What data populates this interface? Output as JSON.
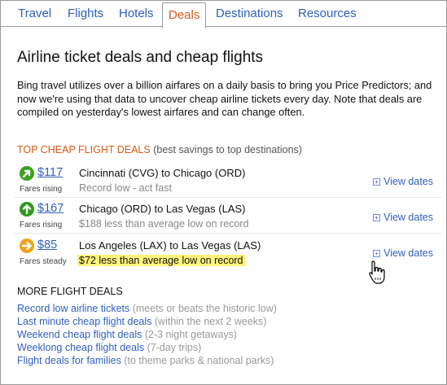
{
  "tabs": [
    {
      "label": "Travel",
      "active": false
    },
    {
      "label": "Flights",
      "active": false
    },
    {
      "label": "Hotels",
      "active": false
    },
    {
      "label": "Deals",
      "active": true
    },
    {
      "label": "Destinations",
      "active": false
    },
    {
      "label": "Resources",
      "active": false
    }
  ],
  "page_title": "Airline ticket deals and cheap flights",
  "intro": "Bing travel utilizes over a billion airfares on a daily basis to bring you Price Predictors; and now we're using that data to uncover cheap airline tickets every day. Note that deals are compiled on yesterday's lowest airfares and can change often.",
  "top_deals": {
    "title": "TOP CHEAP FLIGHT DEALS",
    "subtitle": "(best savings to top destinations)",
    "items": [
      {
        "price": "$117",
        "trend": "Fares rising",
        "arrow_color": "#3aa11c",
        "arrow_icon": "arrow-up-right-icon",
        "route": "Cincinnati (CVG) to Chicago (ORD)",
        "note": "Record low - act fast",
        "highlight": false,
        "view_dates": "View dates"
      },
      {
        "price": "$167",
        "trend": "Fares rising",
        "arrow_color": "#2e9a1a",
        "arrow_icon": "arrow-up-icon",
        "route": "Chicago (ORD) to Las Vegas (LAS)",
        "note": "$188 less than average low on record",
        "highlight": false,
        "view_dates": "View dates"
      },
      {
        "price": "$85",
        "trend": "Fares steady",
        "arrow_color": "#f2a31b",
        "arrow_icon": "arrow-right-icon",
        "route": "Los Angeles (LAX) to Las Vegas (LAS)",
        "note": "$72 less than average low on record",
        "highlight": true,
        "view_dates": "View dates"
      }
    ]
  },
  "more_deals": {
    "title": "MORE FLIGHT DEALS",
    "items": [
      {
        "link": "Record low airline tickets",
        "hint": "(meets or beats the historic low)"
      },
      {
        "link": "Last minute cheap flight deals",
        "hint": "(within the next 2 weeks)"
      },
      {
        "link": "Weekend cheap flight deals",
        "hint": "(2-3 night getaways)"
      },
      {
        "link": "Weeklong cheap flight deals",
        "hint": "(7-day trips)"
      },
      {
        "link": "Flight deals for families",
        "hint": "(to theme parks & national parks)"
      }
    ]
  },
  "colors": {
    "link": "#2f5fbb",
    "accent": "#d35a17",
    "highlight": "#fff37a"
  }
}
